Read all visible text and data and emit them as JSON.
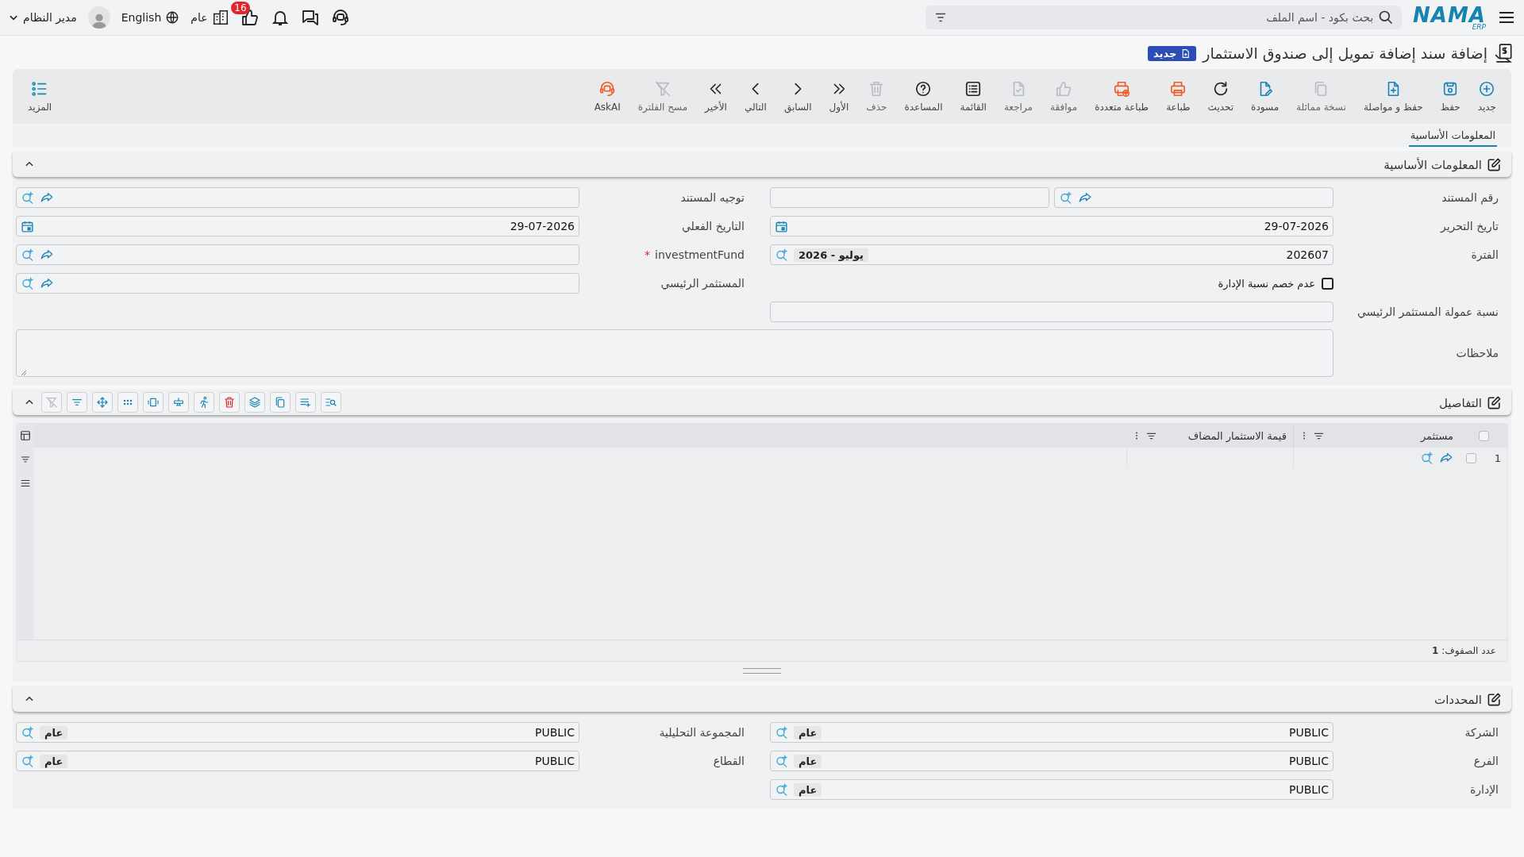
{
  "topbar": {
    "logo": "NAMA",
    "logo_sub": "ERP",
    "search": {
      "placeholder": "بحث بكود - اسم الملف"
    },
    "notifications_badge": "16",
    "branch": "عام",
    "language": "English",
    "user": "مدير النظام"
  },
  "title": "إضافة سند إضافة تمويل إلى صندوق الاستثمار",
  "status_badge": "جديد",
  "toolbar": [
    {
      "kind": "add",
      "label": "جديد",
      "disabled": false
    },
    {
      "kind": "save",
      "label": "حفظ",
      "disabled": false
    },
    {
      "kind": "save-continue",
      "label": "حفظ و مواصلة",
      "disabled": false
    },
    {
      "kind": "copy",
      "label": "نسخة مماثلة",
      "disabled": true
    },
    {
      "kind": "draft",
      "label": "مسودة",
      "disabled": false
    },
    {
      "kind": "refresh",
      "label": "تحديث",
      "disabled": false
    },
    {
      "kind": "print",
      "label": "طباعة",
      "disabled": false
    },
    {
      "kind": "multi-print",
      "label": "طباعة متعددة",
      "disabled": false
    },
    {
      "kind": "approve",
      "label": "موافقة",
      "disabled": true
    },
    {
      "kind": "review",
      "label": "مراجعة",
      "disabled": true
    },
    {
      "kind": "list",
      "label": "القائمة",
      "disabled": false
    },
    {
      "kind": "help",
      "label": "المساعدة",
      "disabled": false
    },
    {
      "kind": "delete",
      "label": "حذف",
      "disabled": true
    },
    {
      "kind": "first",
      "label": "الأول",
      "disabled": false
    },
    {
      "kind": "previous",
      "label": "السابق",
      "disabled": false
    },
    {
      "kind": "next",
      "label": "التالي",
      "disabled": false
    },
    {
      "kind": "last",
      "label": "الأخير",
      "disabled": false
    },
    {
      "kind": "clear-filter",
      "label": "مسح الفلترة",
      "disabled": true
    },
    {
      "kind": "ask-ai",
      "label": "AskAI",
      "disabled": false
    }
  ],
  "more_button": "المزيد",
  "tabs": [
    {
      "label": "المعلومات الأساسية",
      "selected": true
    }
  ],
  "basic_info": {
    "title": "المعلومات الأساسية",
    "expanded": true,
    "fields": [
      {
        "kind": "lookup_split",
        "label": "رقم المستند",
        "link": true
      },
      {
        "kind": "lookup",
        "label": "توجيه المستند",
        "link": true
      },
      {
        "kind": "date",
        "label": "تاريخ التحرير",
        "value": "29-07-2026"
      },
      {
        "kind": "date",
        "label": "التاريخ الفعلي",
        "value": "29-07-2026"
      },
      {
        "kind": "lookup",
        "label": "الفترة",
        "value": "202607",
        "tag": "يوليو - 2026",
        "link": false
      },
      {
        "kind": "lookup",
        "label": "investmentFund",
        "required_mark": "*",
        "link": true
      },
      {
        "kind": "checkbox",
        "label": "عدم خصم نسبة الإدارة",
        "checked": false
      },
      {
        "kind": "lookup",
        "label": "المستثمر الرئيسي",
        "link": true
      },
      {
        "kind": "text",
        "label": "نسبة عمولة المستثمر الرئيسي"
      },
      {
        "kind": "textarea",
        "label": "ملاحظات"
      }
    ]
  },
  "details": {
    "title": "التفاصيل",
    "expanded": true,
    "tools": [
      {
        "kind": "search-list",
        "disabled": false
      },
      {
        "kind": "add-rows",
        "disabled": false
      },
      {
        "kind": "copy",
        "disabled": false
      },
      {
        "kind": "layers",
        "disabled": false
      },
      {
        "kind": "delete",
        "disabled": false
      },
      {
        "kind": "runner",
        "disabled": false
      },
      {
        "kind": "insert-row",
        "disabled": false
      },
      {
        "kind": "fit",
        "disabled": false
      },
      {
        "kind": "dots",
        "disabled": false
      },
      {
        "kind": "move",
        "disabled": false
      },
      {
        "kind": "filter",
        "disabled": false
      },
      {
        "kind": "clear-filter",
        "disabled": true
      }
    ],
    "select_all_checked": false,
    "columns": [
      "مستثمر",
      "قيمة الاستثمار المضاف"
    ],
    "rows": [
      {
        "number": "1",
        "selected": false
      }
    ],
    "footer": "عدد الصفوف: **1**"
  },
  "determinants": {
    "title": "المحددات",
    "expanded": true,
    "fields": [
      {
        "kind": "lookup",
        "label": "الشركة",
        "value": "PUBLIC",
        "tag": "عام",
        "link": false
      },
      {
        "kind": "lookup",
        "label": "المجموعة التحليلية",
        "value": "PUBLIC",
        "tag": "عام",
        "link": false
      },
      {
        "kind": "lookup",
        "label": "الفرع",
        "value": "PUBLIC",
        "tag": "عام",
        "link": false
      },
      {
        "kind": "lookup",
        "label": "القطاع",
        "value": "PUBLIC",
        "tag": "عام",
        "link": false
      },
      {
        "kind": "lookup",
        "label": "الإدارة",
        "value": "PUBLIC",
        "tag": "عام",
        "link": false
      }
    ]
  }
}
